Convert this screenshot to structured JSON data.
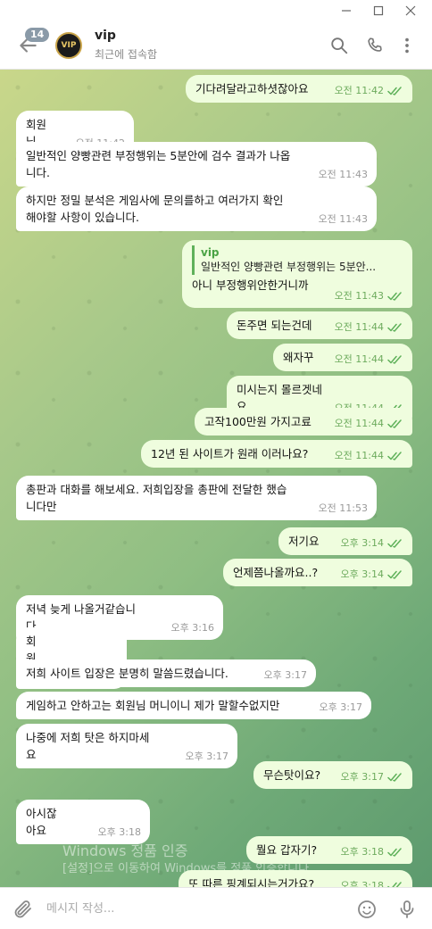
{
  "window": {
    "minimize": "minimize",
    "maximize": "maximize",
    "close": "close"
  },
  "header": {
    "unread_badge": "14",
    "avatar_text": "VIP",
    "name": "vip",
    "status": "최근에 접속함"
  },
  "messages": [
    {
      "dir": "out",
      "text": "기다려달라고하셧잖아요",
      "time": "오전 11:42"
    },
    {
      "dir": "in",
      "text": "회원님",
      "time": "오전 11:42"
    },
    {
      "dir": "in",
      "text": "일반적인 양빵관련 부정행위는 5분안에 검수 결과가 나옵니다.",
      "time": "오전 11:43"
    },
    {
      "dir": "in",
      "text": "하지만 정밀 분석은 게임사에 문의를하고 여러가지 확인해야할 사항이 있습니다.",
      "time": "오전 11:43"
    },
    {
      "dir": "out",
      "reply_name": "vip",
      "reply_text": "일반적인 양빵관련 부정행위는 5분안...",
      "text": "아니 부정행위안한거니까",
      "time": "오전 11:43"
    },
    {
      "dir": "out",
      "text": "돈주면 되는건데",
      "time": "오전 11:44"
    },
    {
      "dir": "out",
      "text": "왜자꾸",
      "time": "오전 11:44"
    },
    {
      "dir": "out",
      "text": "미시는지 몰르겟네요",
      "time": "오전 11:44"
    },
    {
      "dir": "out",
      "text": "고작100만원 가지고료",
      "time": "오전 11:44"
    },
    {
      "dir": "out",
      "text": "12년 된 사이트가 원래 이러나요?",
      "time": "오전 11:44"
    },
    {
      "dir": "in",
      "text": "총판과 대화를 해보세요. 저희입장을 총판에 전달한 했습니다만",
      "time": "오전 11:53"
    },
    {
      "dir": "out",
      "text": "저기요",
      "time": "오후 3:14"
    },
    {
      "dir": "out",
      "text": "언제쯤나올까요..?",
      "time": "오후 3:14"
    },
    {
      "dir": "in",
      "text": "저녁 늦게 나올거같습니다",
      "time": "오후 3:16"
    },
    {
      "dir": "in",
      "text": "회원님",
      "time": "오후 3:16"
    },
    {
      "dir": "in",
      "text": "저희 사이트 입장은 분명히 말씀드렸습니다.",
      "time": "오후 3:17"
    },
    {
      "dir": "in",
      "text": "게임하고 안하고는 회원님 머니이니 제가 말할수없지만",
      "time": "오후 3:17"
    },
    {
      "dir": "in",
      "text": "나중에 저희 탓은 하지마세요",
      "time": "오후 3:17"
    },
    {
      "dir": "out",
      "text": "무슨탓이요?",
      "time": "오후 3:17"
    },
    {
      "dir": "in",
      "text": "아시잖아요",
      "time": "오후 3:18"
    },
    {
      "dir": "out",
      "text": "뭘요 갑자기?",
      "time": "오후 3:18"
    },
    {
      "dir": "out",
      "text": "또 따른 핑계되시는거가요?",
      "time": "오후 3:18"
    }
  ],
  "watermark": {
    "line1": "Windows 정품 인증",
    "line2": "[설정]으로 이동하여 Windows를 정품 인증합니다."
  },
  "composer": {
    "placeholder": "메시지 작성..."
  },
  "icons": [
    "back-arrow-icon",
    "search-icon",
    "phone-icon",
    "more-vert-icon",
    "attach-icon",
    "emoji-icon",
    "mic-icon",
    "chevron-down-icon",
    "double-check-icon"
  ]
}
